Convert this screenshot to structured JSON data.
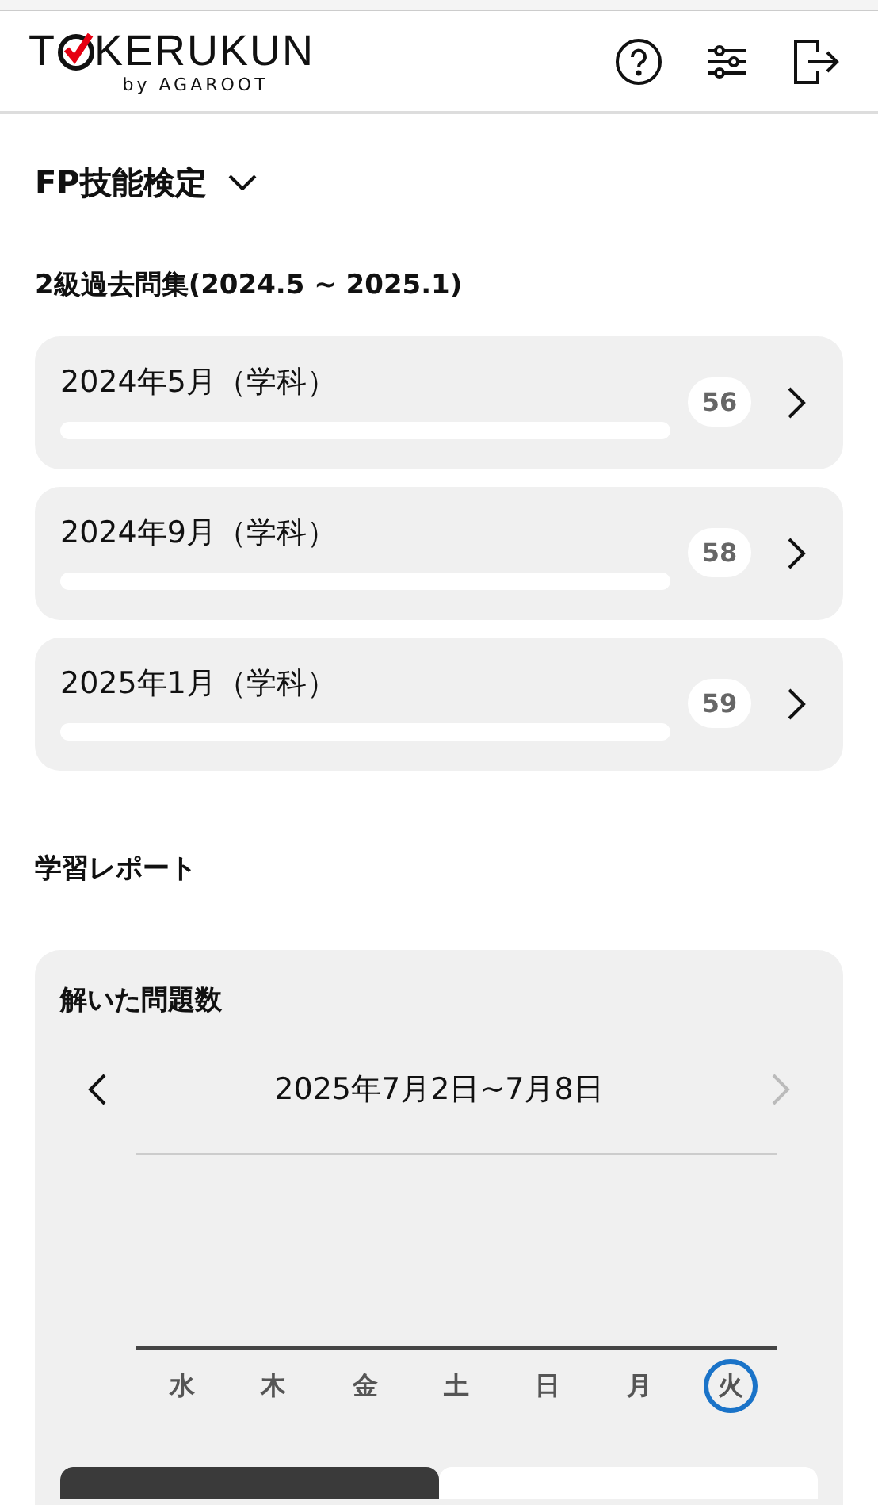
{
  "header": {
    "logo_start": "T",
    "logo_end": "KERUKUN",
    "logo_byline": "by AGAROOT"
  },
  "exam": {
    "title": "FP技能検定"
  },
  "section_title": "2級過去問集(2024.5 ~ 2025.1)",
  "sets": [
    {
      "title": "2024年5月（学科）",
      "count": "56",
      "level": 0
    },
    {
      "title": "2024年9月（学科）",
      "count": "58",
      "level": 0
    },
    {
      "title": "2025年1月（学科）",
      "count": "59",
      "level": 0
    }
  ],
  "report": {
    "title": "学習レポート",
    "card_title": "解いた問題数",
    "range": "2025年7月2日~7月8日",
    "prev_disabled": false,
    "next_disabled": true,
    "days": [
      {
        "label": "水",
        "selected": false
      },
      {
        "label": "木",
        "selected": false
      },
      {
        "label": "金",
        "selected": false
      },
      {
        "label": "土",
        "selected": false
      },
      {
        "label": "日",
        "selected": false
      },
      {
        "label": "月",
        "selected": false
      },
      {
        "label": "火",
        "selected": true
      }
    ],
    "segments": [
      {
        "selected": true
      },
      {
        "selected": false
      }
    ]
  }
}
